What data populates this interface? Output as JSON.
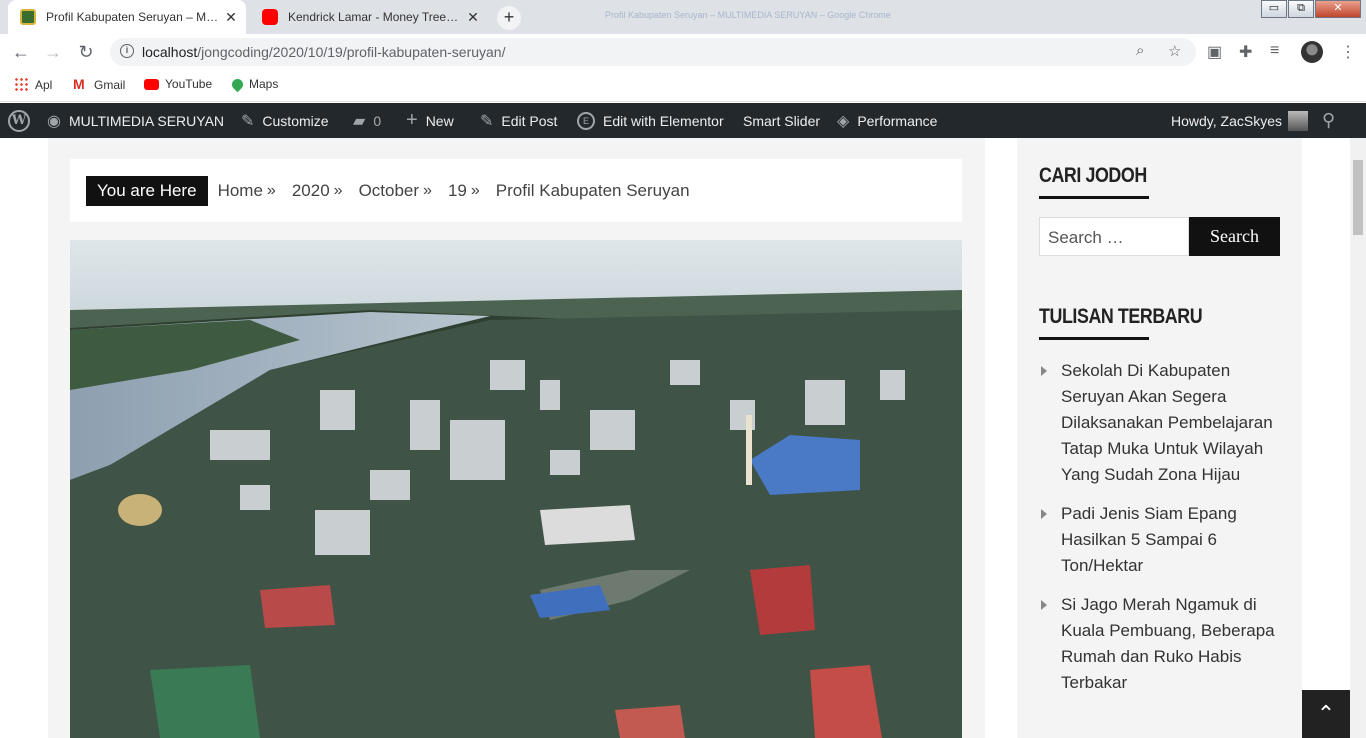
{
  "browser": {
    "tabs": [
      {
        "title": "Profil Kabupaten Seruyan – MULTIMEDIA SERUYAN",
        "favicon_color": "#3a6e2e",
        "active": true
      },
      {
        "title": "Kendrick Lamar - Money Trees (L",
        "favicon_color": "#ff0000",
        "active": false
      }
    ],
    "new_tab_symbol": "+",
    "close_symbol": "✕",
    "window_title": "Profil Kabupaten Seruyan – MULTIMEDIA SERUYAN – Google Chrome",
    "window_controls": {
      "minimize": "▭",
      "maximize": "⧉",
      "close": "✕"
    },
    "url_host": "localhost",
    "url_path": "/jongcoding/2020/10/19/profil-kabupaten-seruyan/",
    "bookmarks": [
      {
        "label": "Apl",
        "icon": "apps-grid-icon"
      },
      {
        "label": "Gmail",
        "icon": "gmail-icon"
      },
      {
        "label": "YouTube",
        "icon": "youtube-icon"
      },
      {
        "label": "Maps",
        "icon": "maps-pin-icon"
      }
    ]
  },
  "adminbar": {
    "site_name": "MULTIMEDIA SERUYAN",
    "customize": "Customize",
    "comments_count": "0",
    "new": "New",
    "edit_post": "Edit Post",
    "edit_elementor": "Edit with Elementor",
    "smart_slider": "Smart Slider",
    "performance": "Performance",
    "howdy": "Howdy, ZacSkyes"
  },
  "breadcrumb": {
    "here_label": "You are Here",
    "separator": "»",
    "items": [
      "Home",
      "2020",
      "October",
      "19",
      "Profil Kabupaten Seruyan"
    ]
  },
  "sidebar": {
    "search_widget_title": "CARI JODOH",
    "search_placeholder": "Search …",
    "search_button": "Search",
    "recent_title": "TULISAN TERBARU",
    "recent_posts": [
      "Sekolah Di Kabupaten Seruyan Akan Segera Dilaksanakan Pembelajaran Tatap Muka Untuk Wilayah Yang Sudah Zona Hijau",
      "Padi Jenis Siam Epang Hasilkan 5 Sampai 6 Ton/Hektar",
      "Si Jago Merah Ngamuk di Kuala Pembuang, Beberapa Rumah dan Ruko Habis Terbakar"
    ]
  },
  "back_to_top_symbol": "⌃"
}
